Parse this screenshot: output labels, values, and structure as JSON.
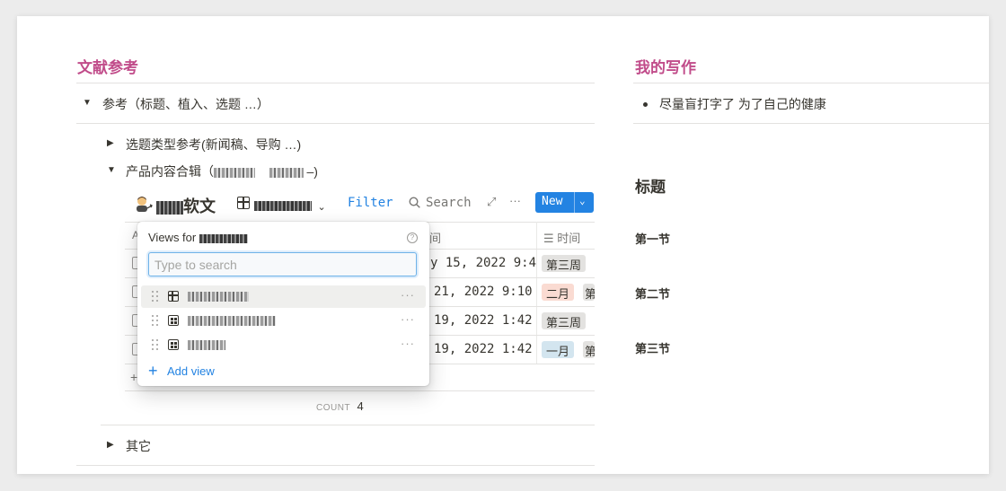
{
  "left": {
    "heading": "文献参考",
    "toggle_main": "参考（标题、植入、选题 …）",
    "toggle_topic": "选题类型参考(新闻稿、导购 …)",
    "toggle_product_prefix": "产品内容合辑（",
    "toggle_product_suffix": "–)",
    "toggle_other": "其它"
  },
  "database": {
    "title_suffix": "软文",
    "filter_label": "Filter",
    "search_label": "Search",
    "new_label": "New",
    "more_label": "···",
    "column_time": "时间",
    "column_date_cut": "间",
    "count_label": "COUNT",
    "count_value": "4",
    "rows": [
      {
        "date": "y 15, 2022 9:4",
        "tag": "第三周",
        "tag_color": "#e3e2e0",
        "tag2": ""
      },
      {
        "date": "21, 2022 9:10",
        "tag": "二月",
        "tag_color": "#fadbd2",
        "tag2": "第"
      },
      {
        "date": "19, 2022 1:42",
        "tag": "第三周",
        "tag_color": "#e3e2e0",
        "tag2": ""
      },
      {
        "date": "19, 2022 1:42",
        "tag": "一月",
        "tag_color": "#d3e5ef",
        "tag2": "第"
      }
    ]
  },
  "popup": {
    "title_prefix": "Views for",
    "search_placeholder": "Type to search",
    "add_view_label": "Add view",
    "more_label": "···"
  },
  "right": {
    "heading": "我的写作",
    "bullet": "尽量盲打字了  为了自己的健康",
    "title_heading": "标题",
    "sections": [
      "第一节",
      "第二节",
      "第三节"
    ]
  },
  "colors": {
    "accent_pink": "#c14c8a",
    "accent_blue": "#2383e2",
    "text": "#37352f"
  }
}
